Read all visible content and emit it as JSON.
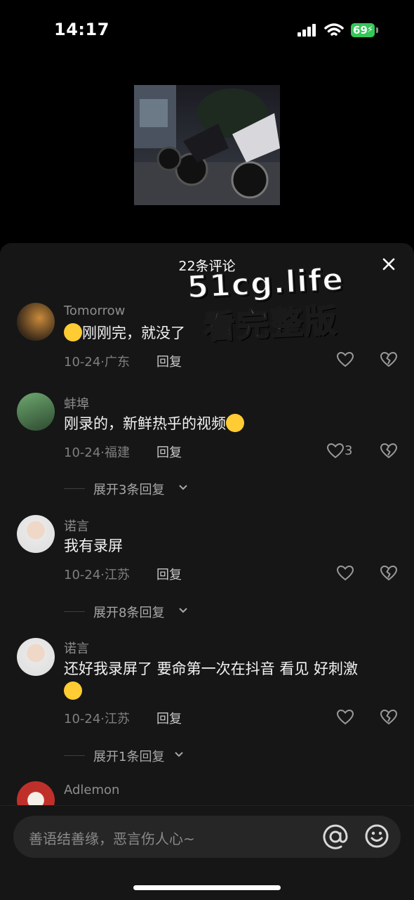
{
  "status_bar": {
    "time": "14:17",
    "battery": "69"
  },
  "sheet": {
    "title": "22条评论"
  },
  "watermark": {
    "line1": "51cg.life",
    "line2": "看完整版"
  },
  "comments": [
    {
      "user": "Tomorrow",
      "text": "刚刚完，就没了",
      "date": "10-24·广东",
      "reply": "回复",
      "likes": ""
    },
    {
      "user": "蚌埠",
      "text": "刚录的，新鲜热乎的视频",
      "date": "10-24·福建",
      "reply": "回复",
      "likes": "3",
      "expand": "展开3条回复"
    },
    {
      "user": "诺言",
      "text": "我有录屏",
      "date": "10-24·江苏",
      "reply": "回复",
      "likes": "",
      "expand": "展开8条回复"
    },
    {
      "user": "诺言",
      "text": "还好我录屏了 要命第一次在抖音 看见 好刺激",
      "date": "10-24·江苏",
      "reply": "回复",
      "likes": "",
      "expand": "展开1条回复"
    },
    {
      "user": "Adlemon"
    }
  ],
  "input": {
    "placeholder": "善语结善缘，恶言伤人心~"
  },
  "colors": {
    "battery": "#34c759",
    "sheet_bg": "#161616",
    "input_bg": "#262626"
  },
  "icons": [
    "signal-icon",
    "wifi-icon",
    "battery-icon",
    "close-icon",
    "heart-icon",
    "broken-heart-icon",
    "chevron-down-icon",
    "at-icon",
    "emoji-icon"
  ]
}
